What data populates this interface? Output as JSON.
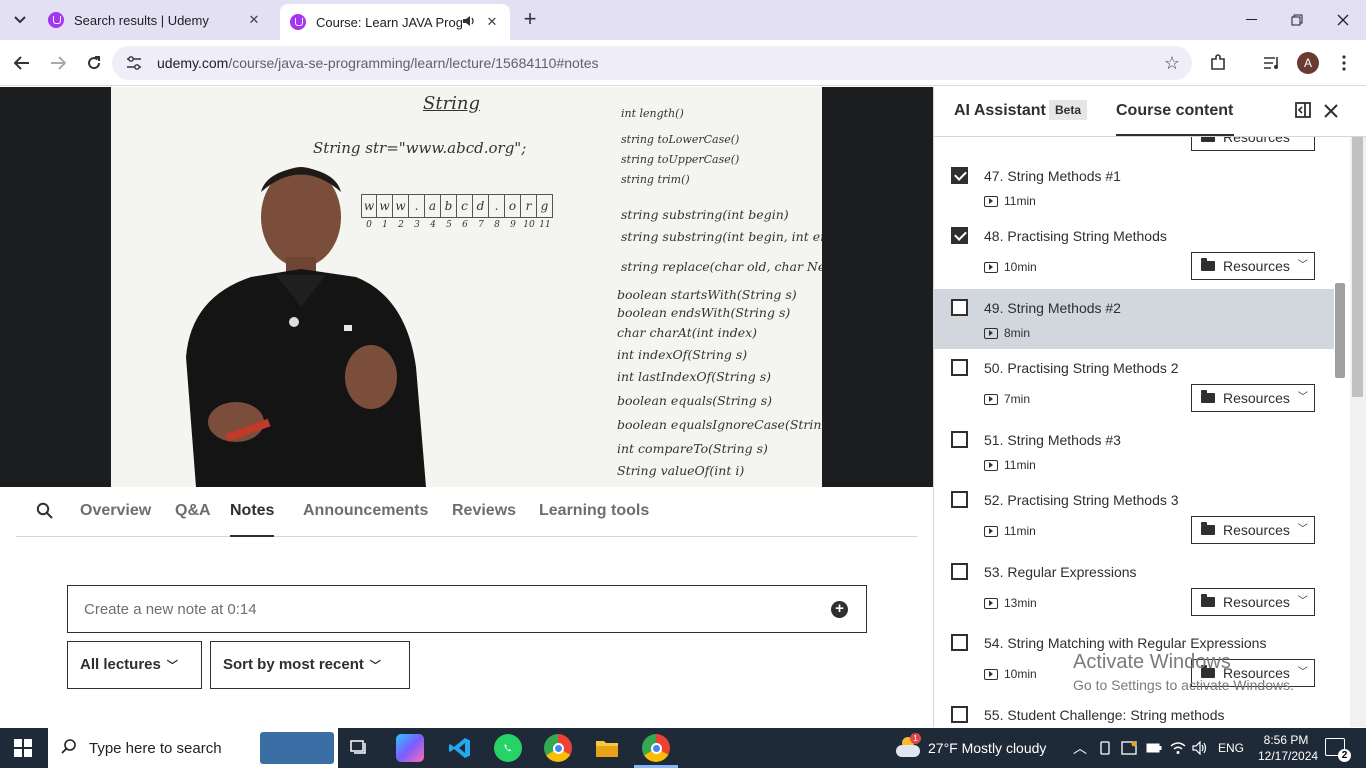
{
  "browser": {
    "tabs": [
      {
        "title": "Search results | Udemy",
        "active": false
      },
      {
        "title": "Course: Learn JAVA Program",
        "active": true
      }
    ],
    "url_host": "udemy.com",
    "url_path": "/course/java-se-programming/learn/lecture/15684110#notes",
    "profile_initial": "A"
  },
  "video": {
    "board_title": "String",
    "declaration": "String str=\"www.abcd.org\";",
    "array_chars": [
      "w",
      "w",
      "w",
      ".",
      "a",
      "b",
      "c",
      "d",
      ".",
      "o",
      "r",
      "g"
    ],
    "array_indices": [
      "0",
      "1",
      "2",
      "3",
      "4",
      "5",
      "6",
      "7",
      "8",
      "9",
      "10",
      "11"
    ],
    "methods": [
      "int length()",
      "string toLowerCase()",
      "string toUpperCase()",
      "string trim()",
      "string substring(int begin)",
      "string substring(int begin, int end",
      "string replace(char old, char New)",
      "boolean startsWith(String s)",
      "boolean endsWith(String s)",
      "char charAt(int index)",
      "int indexOf(String s)",
      "int lastIndexOf(String s)",
      "boolean equals(String s)",
      "boolean equalsIgnoreCase(String s)",
      "int compareTo(String s)",
      "String valueOf(int i)"
    ]
  },
  "course_tabs": [
    "Overview",
    "Q&A",
    "Notes",
    "Announcements",
    "Reviews",
    "Learning tools"
  ],
  "active_course_tab": "Notes",
  "notes": {
    "placeholder": "Create a new note at 0:14",
    "filter_lectures": "All lectures",
    "sort": "Sort by most recent"
  },
  "sidebar": {
    "ai_assistant": "AI Assistant",
    "beta": "Beta",
    "course_content": "Course content",
    "resources_label": "Resources",
    "lectures": [
      {
        "title": "47. String Methods #1",
        "duration": "11min",
        "checked": true,
        "resources": false,
        "current": false
      },
      {
        "title": "48. Practising String Methods",
        "duration": "10min",
        "checked": true,
        "resources": true,
        "current": false
      },
      {
        "title": "49. String Methods #2",
        "duration": "8min",
        "checked": false,
        "resources": false,
        "current": true
      },
      {
        "title": "50. Practising String Methods 2",
        "duration": "7min",
        "checked": false,
        "resources": true,
        "current": false
      },
      {
        "title": "51. String Methods #3",
        "duration": "11min",
        "checked": false,
        "resources": false,
        "current": false
      },
      {
        "title": "52. Practising String Methods 3",
        "duration": "11min",
        "checked": false,
        "resources": true,
        "current": false
      },
      {
        "title": "53. Regular Expressions",
        "duration": "13min",
        "checked": false,
        "resources": true,
        "current": false
      },
      {
        "title": "54. String Matching with Regular Expressions",
        "duration": "10min",
        "checked": false,
        "resources": true,
        "current": false
      },
      {
        "title": "55. Student Challenge: String methods",
        "duration": "",
        "checked": false,
        "resources": false,
        "current": false
      }
    ]
  },
  "watermark": {
    "line1": "Activate Windows",
    "line2": "Go to Settings to activate Windows."
  },
  "taskbar": {
    "search_placeholder": "Type here to search",
    "weather": "27°F  Mostly cloudy",
    "language": "ENG",
    "time": "8:56 PM",
    "date": "12/17/2024",
    "weather_badge": "1",
    "notification_count": "2"
  },
  "colors": {
    "udemy_purple": "#a435f0",
    "tab_strip": "#e3e0f3",
    "taskbar": "#1f2a38",
    "current_lecture_bg": "#d1d7dc"
  }
}
